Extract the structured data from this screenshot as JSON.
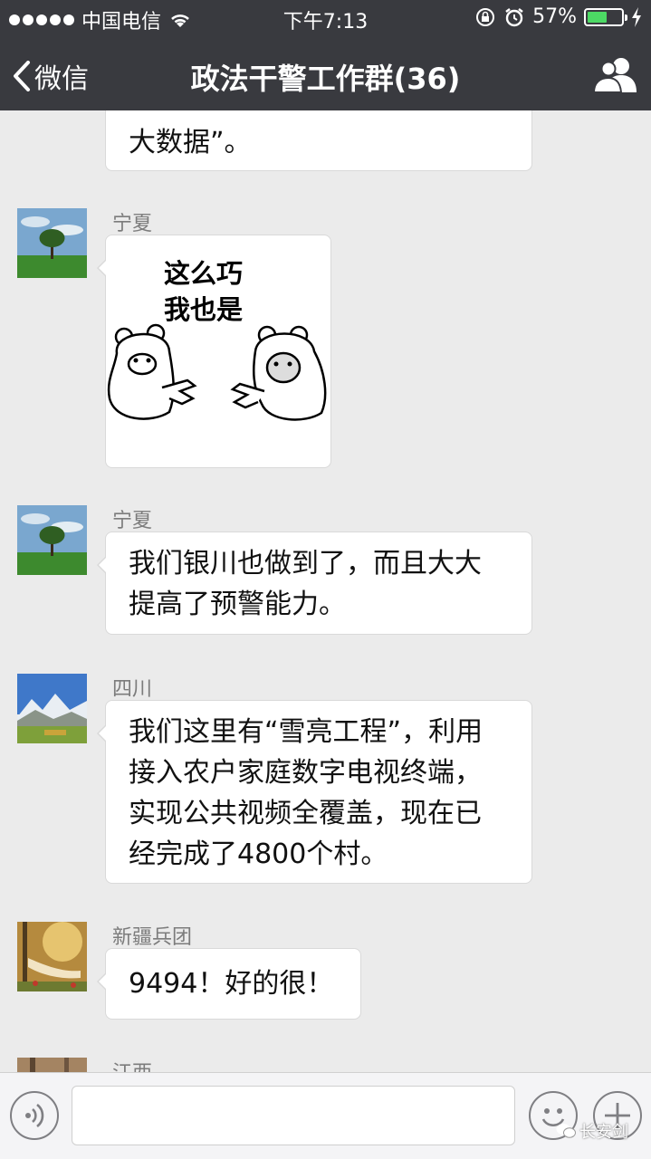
{
  "status_bar": {
    "carrier": "中国电信",
    "time": "下午7:13",
    "battery_percent": "57%",
    "battery_level": 0.57
  },
  "nav": {
    "back_label": "微信",
    "title": "政法干警工作群(36)"
  },
  "messages": [
    {
      "sender": "",
      "text_lines": [
        "大数据”。"
      ]
    },
    {
      "sender": "宁夏",
      "sticker_text_lines": [
        "这么巧",
        "我也是"
      ]
    },
    {
      "sender": "宁夏",
      "text_lines": [
        "我们银川也做到了，而且大大",
        "提高了预警能力。"
      ]
    },
    {
      "sender": "四川",
      "text_lines": [
        "我们这里有“雪亮工程”，利用",
        "接入农户家庭数字电视终端，",
        "实现公共视频全覆盖，现在已",
        "经完成了4800个村。"
      ]
    },
    {
      "sender": "新疆兵团",
      "text_lines": [
        "9494！好的很！"
      ]
    },
    {
      "sender": "江西"
    }
  ],
  "watermark": "长安剑",
  "colors": {
    "header_bg": "#393a3f",
    "chat_bg": "#ebebeb",
    "battery_fill": "#4cd964"
  }
}
